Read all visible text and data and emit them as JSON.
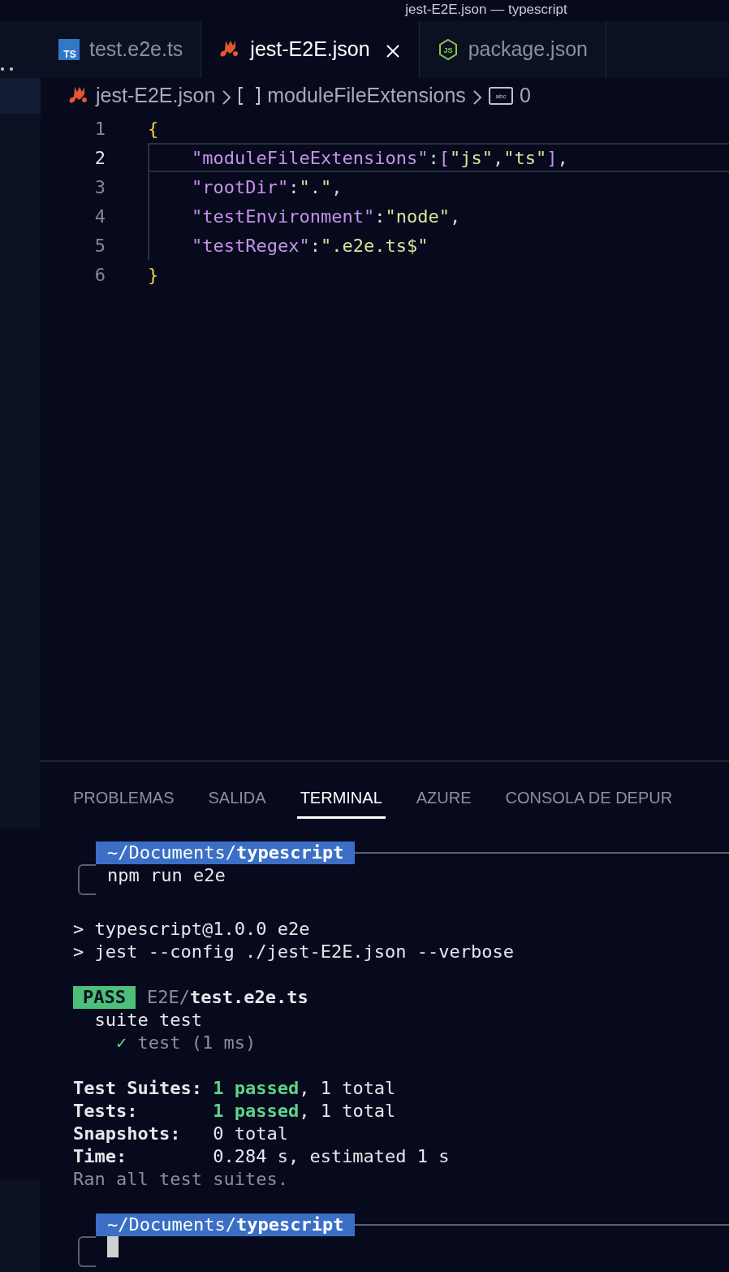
{
  "window": {
    "title": "jest-E2E.json — typescript"
  },
  "tabs": [
    {
      "label": "test.e2e.ts",
      "kind": "ts",
      "icon_text": "TS",
      "selected": false,
      "closable": false
    },
    {
      "label": "jest-E2E.json",
      "kind": "jest",
      "selected": true,
      "closable": true
    },
    {
      "label": "package.json",
      "kind": "node",
      "icon_text": "JS",
      "selected": false,
      "closable": false
    }
  ],
  "breadcrumb": [
    {
      "label": "jest-E2E.json",
      "kind": "jest"
    },
    {
      "label": "moduleFileExtensions",
      "kind": "array"
    },
    {
      "label": "0",
      "kind": "string",
      "icon_text": "abc"
    }
  ],
  "editor": {
    "lines": [
      {
        "number": "1",
        "current": false,
        "tokens": [
          {
            "text": "{",
            "kind": "brace"
          }
        ]
      },
      {
        "number": "2",
        "current": true,
        "tokens": [
          {
            "text": "\"moduleFileExtensions\"",
            "kind": "key"
          },
          {
            "text": ":",
            "kind": "punct"
          },
          {
            "text": "[",
            "kind": "bracket"
          },
          {
            "text": "\"js\"",
            "kind": "string"
          },
          {
            "text": ",",
            "kind": "punct"
          },
          {
            "text": "\"ts\"",
            "kind": "string"
          },
          {
            "text": "]",
            "kind": "bracket"
          },
          {
            "text": ",",
            "kind": "punct"
          }
        ]
      },
      {
        "number": "3",
        "current": false,
        "tokens": [
          {
            "text": "\"rootDir\"",
            "kind": "key"
          },
          {
            "text": ":",
            "kind": "punct"
          },
          {
            "text": "\".\"",
            "kind": "string"
          },
          {
            "text": ",",
            "kind": "punct"
          }
        ]
      },
      {
        "number": "4",
        "current": false,
        "tokens": [
          {
            "text": "\"testEnvironment\"",
            "kind": "key"
          },
          {
            "text": ":",
            "kind": "punct"
          },
          {
            "text": "\"node\"",
            "kind": "string"
          },
          {
            "text": ",",
            "kind": "punct"
          }
        ]
      },
      {
        "number": "5",
        "current": false,
        "tokens": [
          {
            "text": "\"testRegex\"",
            "kind": "key"
          },
          {
            "text": ":",
            "kind": "punct"
          },
          {
            "text": "\".e2e.ts$\"",
            "kind": "string"
          }
        ]
      },
      {
        "number": "6",
        "current": false,
        "tokens": [
          {
            "text": "}",
            "kind": "brace"
          }
        ]
      }
    ]
  },
  "panel": {
    "tabs": [
      {
        "label": "PROBLEMAS",
        "selected": false
      },
      {
        "label": "SALIDA",
        "selected": false
      },
      {
        "label": "TERMINAL",
        "selected": true
      },
      {
        "label": "AZURE",
        "selected": false
      },
      {
        "label": "CONSOLA DE DEPUR",
        "selected": false
      }
    ],
    "terminal": [
      {
        "kind": "prompt",
        "path": "~/Documents/**typescript**",
        "command": "npm run e2e"
      },
      {
        "kind": "blank"
      },
      {
        "kind": "text",
        "segments": [
          {
            "text": "> typescript@1.0.0 e2e",
            "kind": "plain"
          }
        ]
      },
      {
        "kind": "text",
        "segments": [
          {
            "text": "> jest --config ./jest-E2E.json --verbose",
            "kind": "plain"
          }
        ]
      },
      {
        "kind": "blank"
      },
      {
        "kind": "text",
        "segments": [
          {
            "text": "PASS",
            "kind": "badge"
          },
          {
            "text": "E2E/",
            "kind": "dim"
          },
          {
            "text": "test.e2e.ts",
            "kind": "bold"
          }
        ]
      },
      {
        "kind": "text",
        "segments": [
          {
            "text": "  suite test",
            "kind": "plain"
          }
        ]
      },
      {
        "kind": "text",
        "segments": [
          {
            "text": "    ✓",
            "kind": "check"
          },
          {
            "text": " test (1 ms)",
            "kind": "dim"
          }
        ]
      },
      {
        "kind": "blank"
      },
      {
        "kind": "text",
        "segments": [
          {
            "text": "Test Suites: ",
            "kind": "bold"
          },
          {
            "text": "1 passed",
            "kind": "pass"
          },
          {
            "text": ", 1 total",
            "kind": "plain"
          }
        ]
      },
      {
        "kind": "text",
        "segments": [
          {
            "text": "Tests:       ",
            "kind": "bold"
          },
          {
            "text": "1 passed",
            "kind": "pass"
          },
          {
            "text": ", 1 total",
            "kind": "plain"
          }
        ]
      },
      {
        "kind": "text",
        "segments": [
          {
            "text": "Snapshots:   ",
            "kind": "bold"
          },
          {
            "text": "0 total",
            "kind": "plain"
          }
        ]
      },
      {
        "kind": "text",
        "segments": [
          {
            "text": "Time:        ",
            "kind": "bold"
          },
          {
            "text": "0.284 s, estimated 1 s",
            "kind": "plain"
          }
        ]
      },
      {
        "kind": "text",
        "segments": [
          {
            "text": "Ran all test suites.",
            "kind": "dim"
          }
        ]
      },
      {
        "kind": "blank"
      },
      {
        "kind": "prompt",
        "path": "~/Documents/**typescript**",
        "cursor": true
      }
    ]
  }
}
